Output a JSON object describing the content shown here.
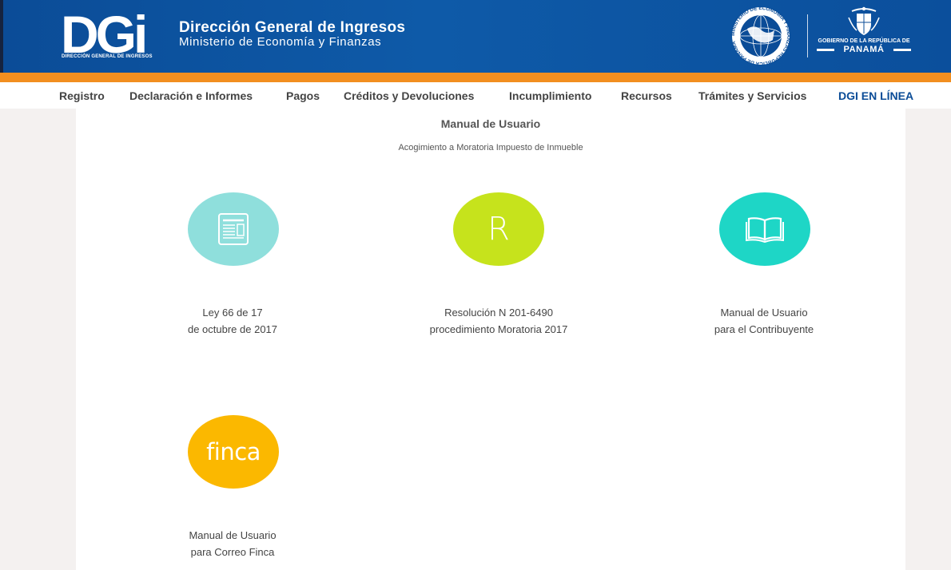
{
  "header": {
    "logo_text": "DGi",
    "logo_caption": "DIRECCIÓN GENERAL DE INGRESOS",
    "org_title": "Dirección General de Ingresos",
    "org_subtitle": "Ministerio de Economía y Finanzas",
    "seal_text": "MINISTERIO DE ECONOMIA Y FINANZAS REPUBLICA DE PANAMA",
    "gov_text": "GOBIERNO DE LA REPÚBLICA DE",
    "gov_country": "PANAMÁ"
  },
  "nav": {
    "items": [
      {
        "label": "Registro"
      },
      {
        "label": "Declaración e Informes"
      },
      {
        "label": "Pagos"
      },
      {
        "label": "Créditos y Devoluciones"
      },
      {
        "label": "Incumplimiento"
      },
      {
        "label": "Recursos"
      },
      {
        "label": "Trámites y Servicios"
      },
      {
        "label": "DGI EN LÍNEA"
      }
    ]
  },
  "main": {
    "title": "Manual de Usuario",
    "subtitle": "Acogimiento a Moratoria Impuesto de Inmueble",
    "cards": [
      {
        "icon": "document-icon",
        "color": "#8fdfdc",
        "line1": "Ley 66 de 17",
        "line2": "de octubre de 2017"
      },
      {
        "icon": "r-letter-icon",
        "color": "#c6e31c",
        "glyph": "R",
        "line1": "Resolución N 201-6490",
        "line2": "procedimiento Moratoria 2017"
      },
      {
        "icon": "open-book-icon",
        "color": "#1ed6c6",
        "line1": "Manual de Usuario",
        "line2": "para el Contribuyente"
      },
      {
        "icon": "finca-icon",
        "color": "#fbb800",
        "glyph": "finca",
        "line1": "Manual de Usuario",
        "line2": "para Correo Finca"
      }
    ]
  },
  "colors": {
    "header_blue": "#0b4c97",
    "orange_accent": "#f28f20",
    "nav_highlight": "#0b4c97"
  }
}
